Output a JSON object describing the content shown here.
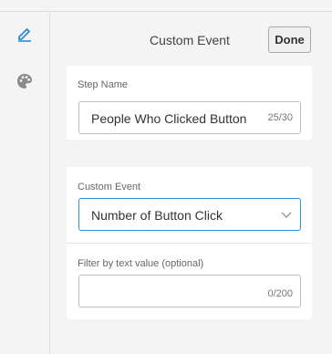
{
  "header": {
    "title": "Custom Event",
    "done_label": "Done"
  },
  "rail": {
    "items": [
      {
        "icon": "pencil-icon",
        "active": true
      },
      {
        "icon": "palette-icon",
        "active": false
      }
    ]
  },
  "step": {
    "label": "Step Name",
    "value": "People Who Clicked Button",
    "counter": "25/30"
  },
  "event": {
    "label": "Custom Event",
    "selected": "Number of Button Click",
    "filter_label": "Filter by text value (optional)",
    "filter_value": "",
    "filter_counter": "0/200"
  },
  "colors": {
    "accent": "#2f8ad0",
    "select_border": "#3a8fc9",
    "palette_icon": "#8a8a8a"
  }
}
